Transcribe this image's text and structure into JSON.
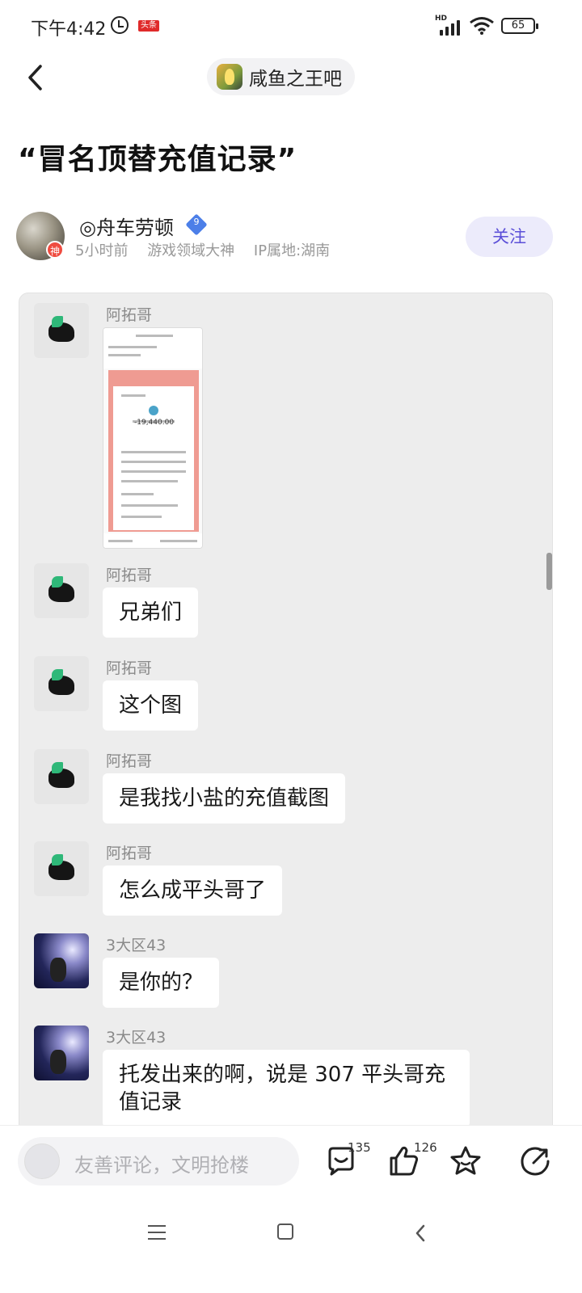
{
  "status_bar": {
    "time": "下午4:42",
    "news_badge": "头条",
    "network": "HD",
    "battery": "65"
  },
  "header": {
    "forum_name": "咸鱼之王吧"
  },
  "post": {
    "title": "“冒名顶替充值记录”"
  },
  "author": {
    "name": "◎舟车劳顿",
    "level": "9",
    "badge": "神",
    "time_ago": "5小时前",
    "tag": "游戏领域大神",
    "ip_location": "IP属地:湖南",
    "follow_label": "关注"
  },
  "chat_screenshot": {
    "messages": [
      {
        "sender": "阿拓哥",
        "text": "",
        "type": "image",
        "image_amount": "-19,440.00"
      },
      {
        "sender": "阿拓哥",
        "text": "兄弟们",
        "type": "text"
      },
      {
        "sender": "阿拓哥",
        "text": "这个图",
        "type": "text"
      },
      {
        "sender": "阿拓哥",
        "text": "是我找小盐的充值截图",
        "type": "text"
      },
      {
        "sender": "阿拓哥",
        "text": "怎么成平头哥了",
        "type": "text"
      },
      {
        "sender": "3大区43",
        "text": "是你的？",
        "type": "text"
      },
      {
        "sender": "3大区43",
        "text": "托发出来的啊，说是 307 平头哥充值记录",
        "type": "text"
      }
    ]
  },
  "comment_bar": {
    "placeholder": "友善评论，文明抢楼",
    "comment_count": "135",
    "like_count": "126"
  },
  "colors": {
    "accent": "#5b4fd8",
    "follow_bg": "#ecebfb",
    "card_bg": "#ededed"
  }
}
